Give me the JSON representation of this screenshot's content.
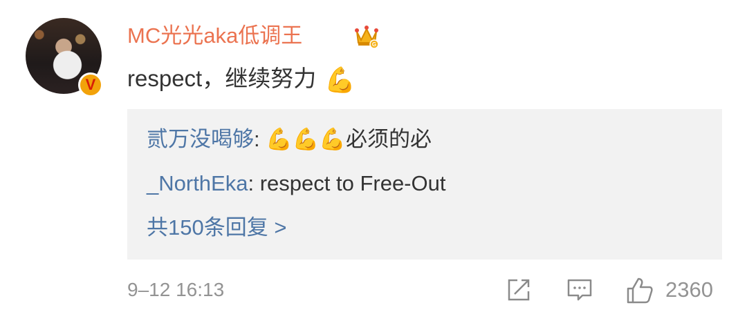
{
  "author": {
    "name": "MC光光aka低调王",
    "verified_badge": "V",
    "avatar_icon": "avatar"
  },
  "comment": {
    "text": "respect，继续努力",
    "emoji": "💪"
  },
  "replies": [
    {
      "user": "贰万没喝够",
      "separator": ": ",
      "emoji": "💪💪💪",
      "text": "必须的必"
    },
    {
      "user": "_NorthEka",
      "separator": ": ",
      "text": "respect to Free-Out"
    }
  ],
  "more_replies": "共150条回复 >",
  "footer": {
    "timestamp": "9–12 16:13",
    "like_count": "2360"
  },
  "colors": {
    "username": "#eb7350",
    "link": "#4e76a6",
    "meta": "#939393",
    "reply_bg": "#f2f2f2"
  }
}
